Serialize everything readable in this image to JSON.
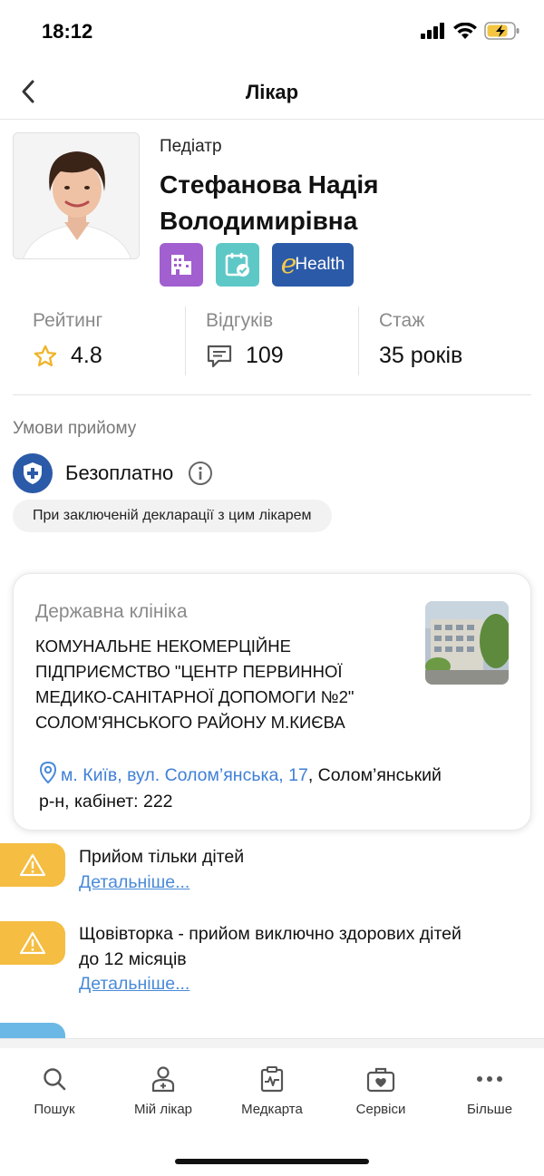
{
  "status_bar": {
    "time": "18:12"
  },
  "nav": {
    "title": "Лікар"
  },
  "doctor": {
    "specialty": "Педіатр",
    "name_line1": "Стефанова Надія",
    "name_line2": "Володимирівна",
    "badges": [
      "clinic-icon",
      "calendar-check-icon",
      "ehealth-logo"
    ],
    "ehealth_text": "Health"
  },
  "stats": {
    "rating_label": "Рейтинг",
    "rating_value": "4.8",
    "reviews_label": "Відгуків",
    "reviews_value": "109",
    "experience_label": "Стаж",
    "experience_value": "35 років"
  },
  "conditions": {
    "label": "Умови прийому",
    "price": "Безоплатно",
    "note": "При заключеній декларації з цим лікарем"
  },
  "clinic": {
    "type": "Державна клініка",
    "name_lines": [
      "КОМУНАЛЬНЕ НЕКОМЕРЦІЙНЕ",
      "ПІДПРИЄМСТВО \"ЦЕНТР ПЕРВИННОЇ",
      "МЕДИКО-САНІТАРНОЇ ДОПОМОГИ №2\"",
      "СОЛОМ'ЯНСЬКОГО РАЙОНУ М.КИЄВА"
    ],
    "address_link": "м. Київ, вул. Солом’янська, 17",
    "address_rest": ", Солом’янський",
    "address_line2": "р-н, кабінет: 222"
  },
  "notices": [
    {
      "lines": [
        "Прийом тільки дітей"
      ],
      "link": "Детальніше..."
    },
    {
      "lines": [
        "Щовівторка - прийом виключно здорових дітей",
        "до 12 місяців"
      ],
      "link": "Детальніше..."
    }
  ],
  "tabs": [
    {
      "label": "Пошук",
      "icon": "search-icon"
    },
    {
      "label": "Мій лікар",
      "icon": "doctor-icon"
    },
    {
      "label": "Медкарта",
      "icon": "medcard-icon"
    },
    {
      "label": "Сервіси",
      "icon": "medkit-icon"
    },
    {
      "label": "Більше",
      "icon": "more-icon"
    }
  ],
  "colors": {
    "accent_blue": "#2b5aa8",
    "link_blue": "#3f7fd6",
    "warning_yellow": "#f5bd41",
    "clinic_purple": "#a25fd0",
    "calendar_teal": "#5ec8c7"
  }
}
